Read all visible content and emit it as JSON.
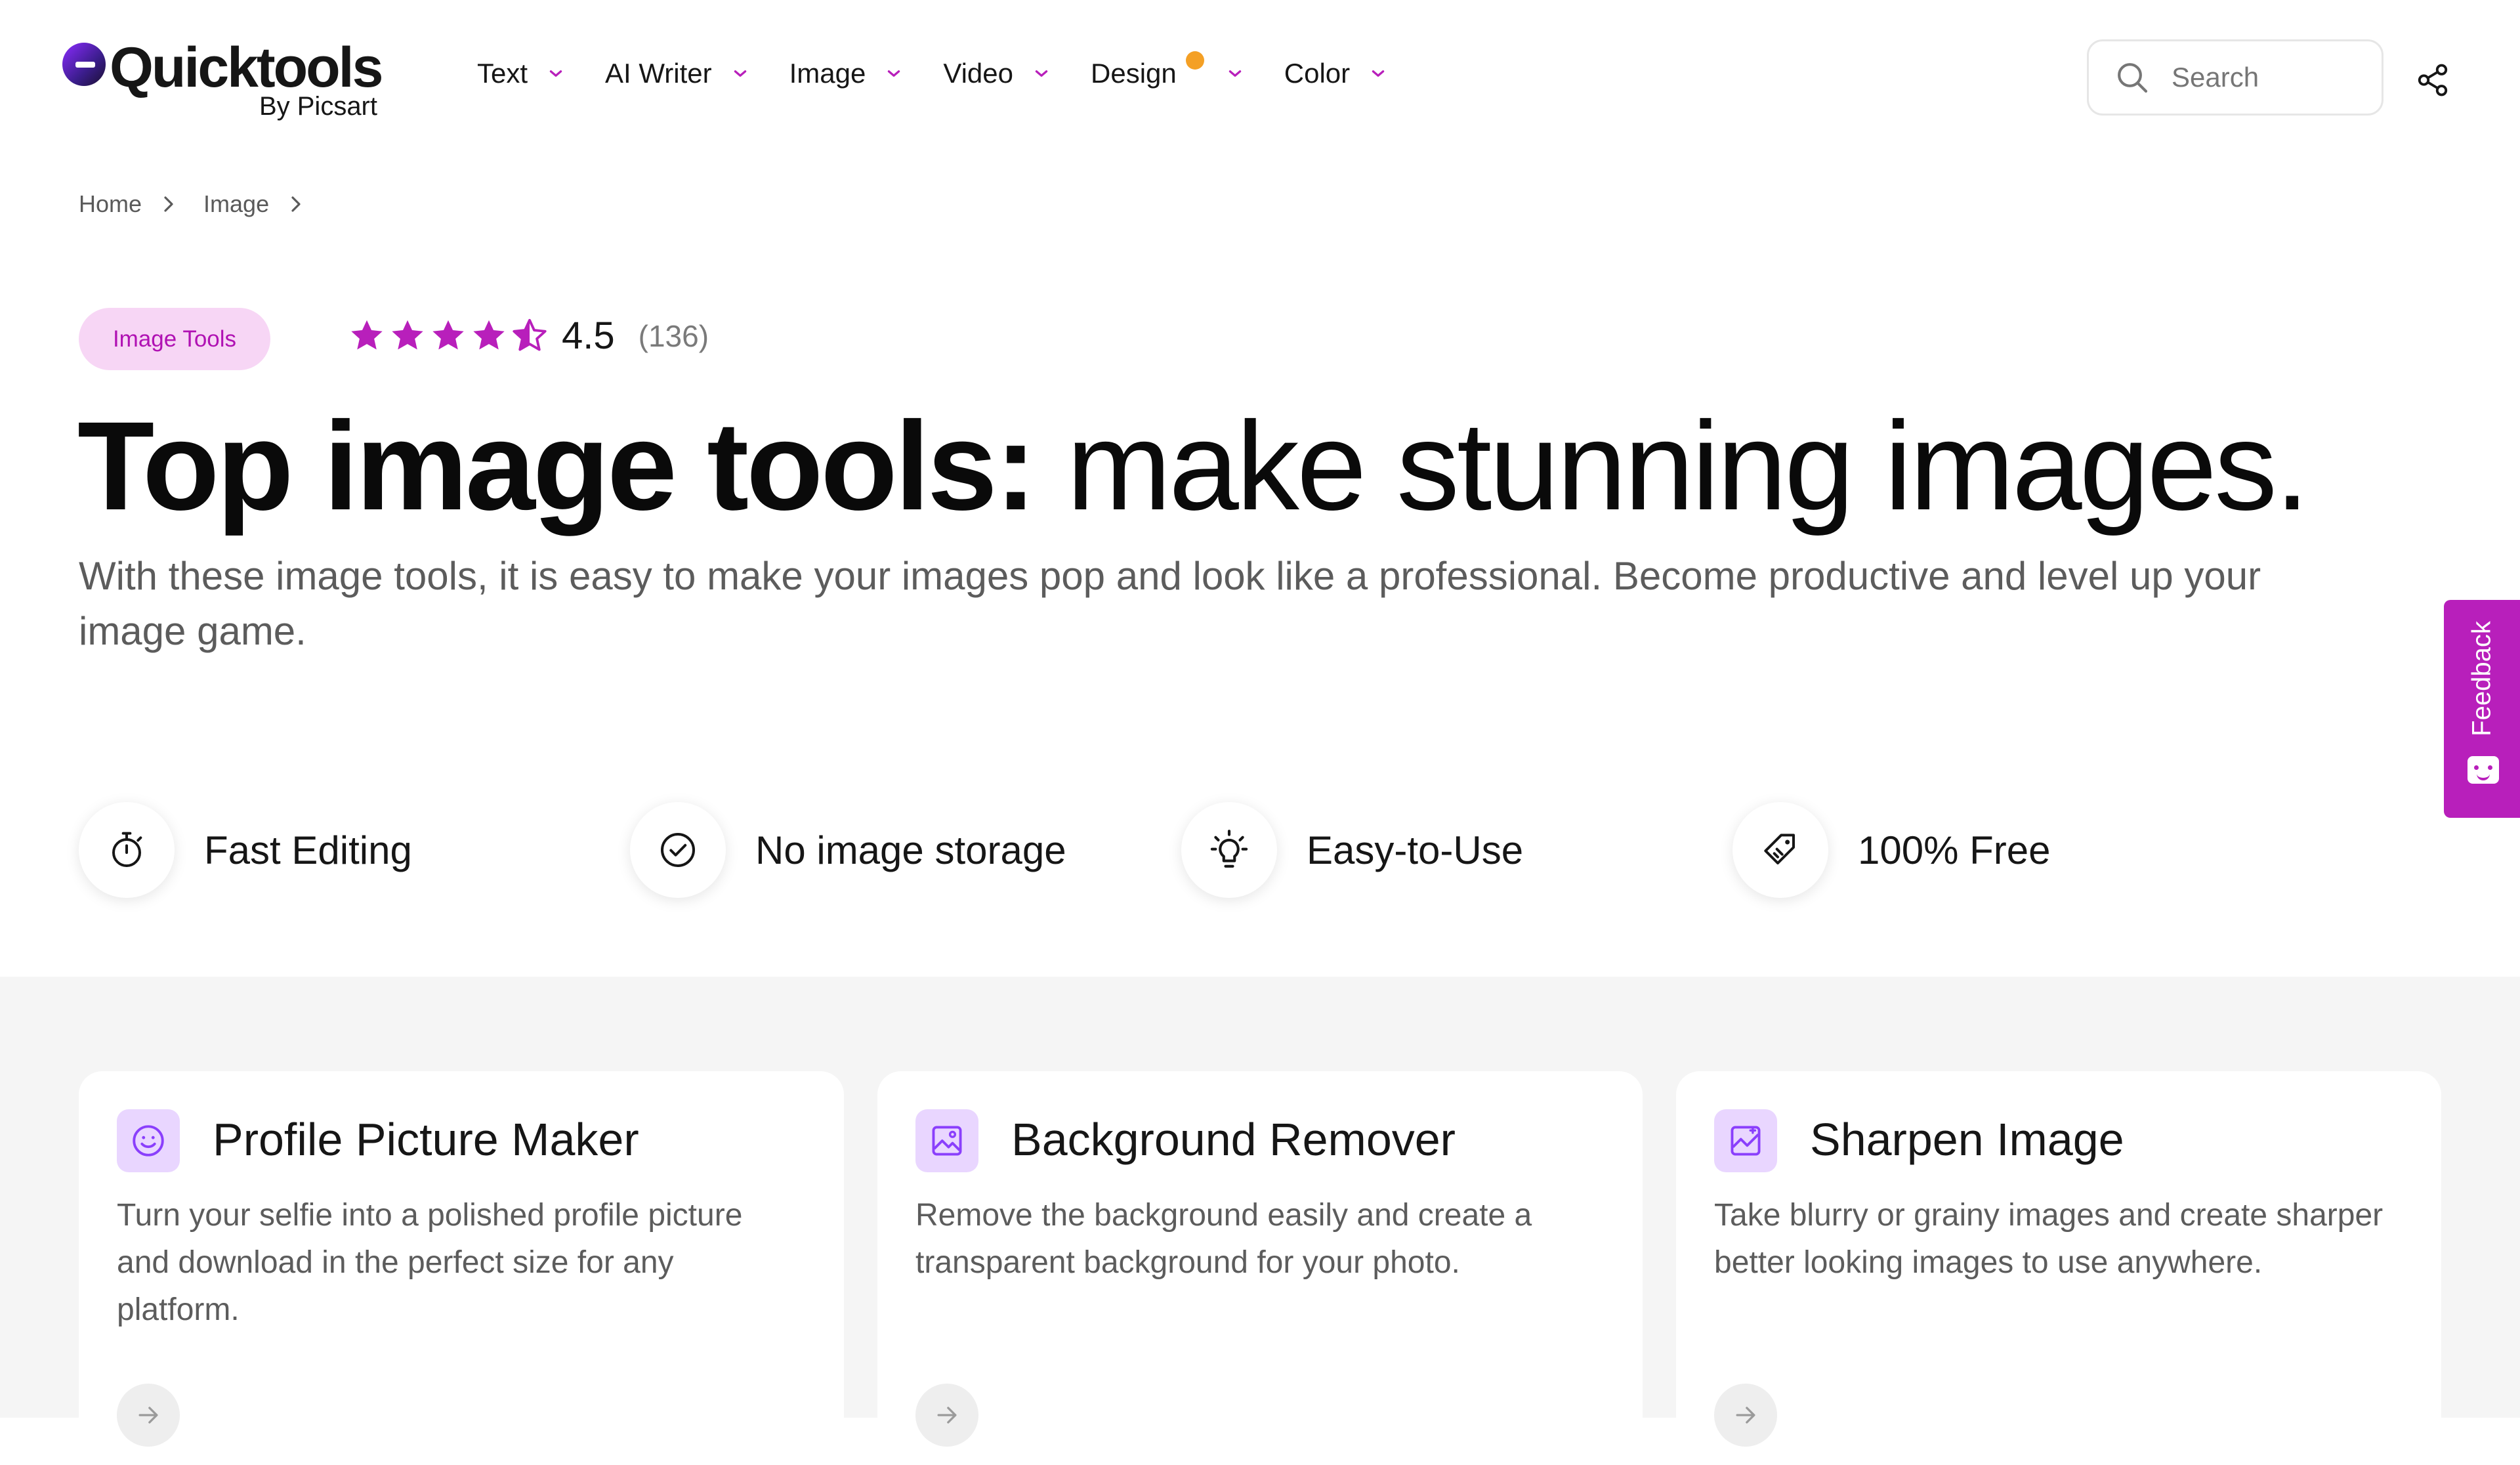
{
  "brand": {
    "name": "Quicktools",
    "sub": "By Picsart",
    "accent": "#b81fbb",
    "badge_bg": "#f7d6f5",
    "dot_color": "#f4a025"
  },
  "nav": {
    "items": [
      {
        "label": "Text"
      },
      {
        "label": "AI Writer"
      },
      {
        "label": "Image"
      },
      {
        "label": "Video"
      },
      {
        "label": "Design"
      },
      {
        "label": "Color"
      }
    ]
  },
  "search": {
    "placeholder": "Search"
  },
  "breadcrumb": {
    "items": [
      "Home",
      "Image"
    ]
  },
  "hero": {
    "badge": "Image Tools",
    "rating": {
      "value": "4.5",
      "count": "(136)",
      "stars": 4.5,
      "max": 5
    },
    "title_bold": "Top image tools:",
    "title_light": " make stunning images.",
    "description": "With these image tools, it is easy to make your images pop and look like a professional. Become productive and level up your image game."
  },
  "feedback": {
    "label": "Feedback"
  },
  "features": [
    {
      "label": "Fast Editing",
      "icon": "stopwatch-icon"
    },
    {
      "label": "No image storage",
      "icon": "check-circle-icon"
    },
    {
      "label": "Easy-to-Use",
      "icon": "lightbulb-icon"
    },
    {
      "label": "100% Free",
      "icon": "tag-icon"
    }
  ],
  "tools": [
    {
      "title": "Profile Picture Maker",
      "icon": "smiley-icon",
      "description": "Turn your selfie into a polished profile picture and download in the perfect size for any platform."
    },
    {
      "title": "Background Remover",
      "icon": "image-edit-icon",
      "description": "Remove the background easily and create a transparent background for your photo."
    },
    {
      "title": "Sharpen Image",
      "icon": "image-sharpen-icon",
      "description": "Take blurry or grainy images and create sharper better looking images to use anywhere."
    }
  ]
}
